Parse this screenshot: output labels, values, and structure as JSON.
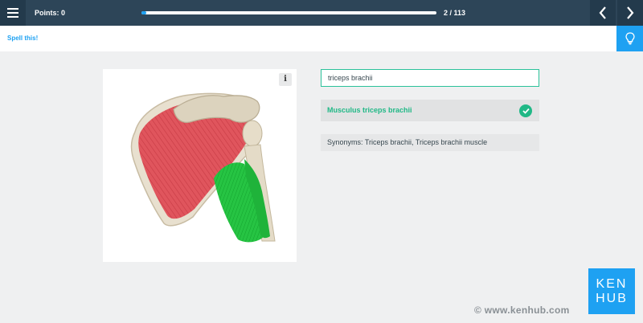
{
  "header": {
    "points_label": "Points: 0",
    "progress_fraction": 0.017,
    "counter": "2 / 113"
  },
  "subheader": {
    "title": "Spell this!"
  },
  "card": {
    "info_glyph": "i",
    "image_icon": "shoulder-muscles-illustration"
  },
  "answer": {
    "input_value": "triceps brachii",
    "result_label": "Musculus triceps brachii",
    "synonyms": "Synonyms: Triceps brachii, Triceps brachii muscle"
  },
  "branding": {
    "url": "© www.kenhub.com",
    "logo_line1": "KEN",
    "logo_line2": "HUB"
  },
  "colors": {
    "accent": "#1ea1f2",
    "header": "#2d4558",
    "success": "#20b886",
    "highlighted_muscle": "#21c43e"
  }
}
